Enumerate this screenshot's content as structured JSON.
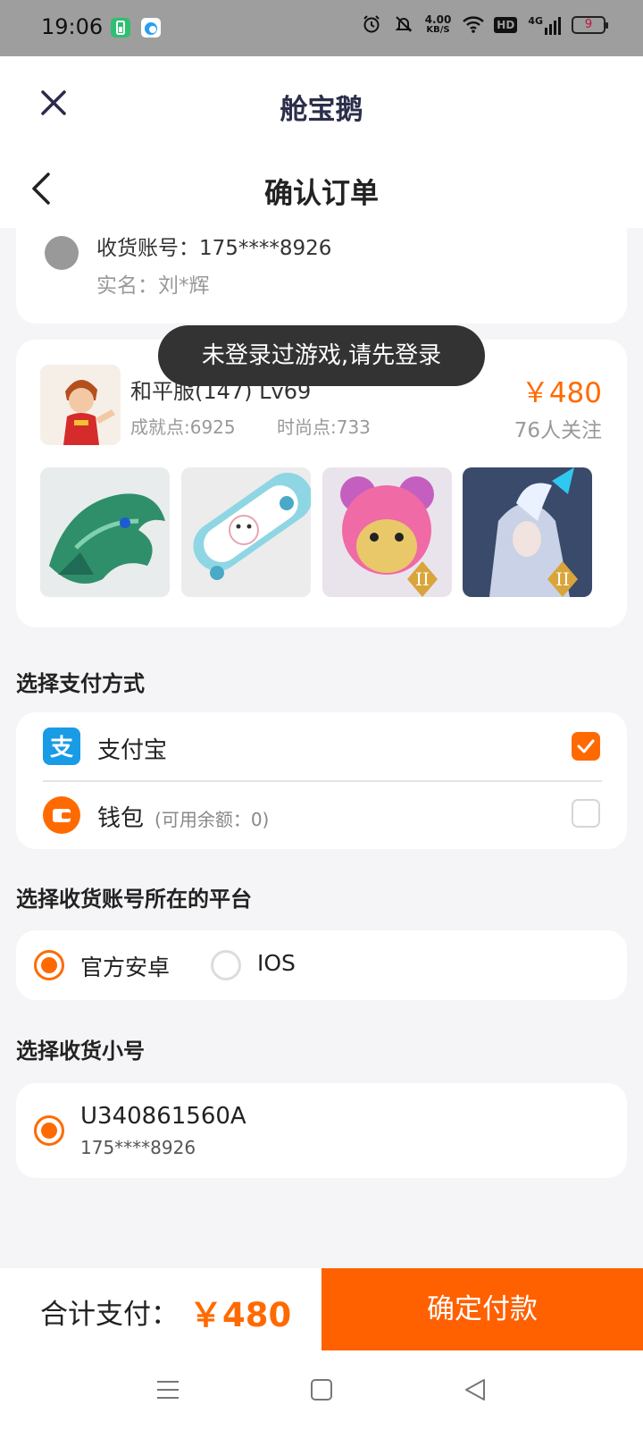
{
  "status_bar": {
    "time": "19:06",
    "speed_value": "4.00",
    "speed_unit": "KB/S",
    "network": "4G",
    "hd_label": "HD",
    "battery": "9",
    "icons": [
      "battery-saver-icon",
      "browser-app-icon",
      "alarm-icon",
      "mute-icon",
      "wifi-icon",
      "hd-icon",
      "signal-icon",
      "battery-icon"
    ]
  },
  "app_bar": {
    "title": "舱宝鹅",
    "close_icon": "close-icon"
  },
  "nav_bar": {
    "title": "确认订单",
    "back_icon": "chevron-left-icon"
  },
  "receiver": {
    "account_line": "收货账号：175****8926",
    "real_name_line": "实名：刘*辉"
  },
  "product": {
    "name": "和平服(147) Lv69",
    "achievement": "成就点:6925",
    "fashion": "时尚点:733",
    "price": "￥480",
    "followers": "76人关注",
    "thumbnails": [
      "dragon-skin",
      "skateboard-skin",
      "pink-bear-skin",
      "armor-skin"
    ]
  },
  "toast": {
    "text": "未登录过游戏,请先登录"
  },
  "payment": {
    "section_title": "选择支付方式",
    "options": [
      {
        "label": "支付宝",
        "sub": "",
        "icon": "alipay-icon",
        "checked": true
      },
      {
        "label": "钱包",
        "sub": "(可用余额：0)",
        "icon": "wallet-icon",
        "checked": false
      }
    ]
  },
  "platform": {
    "section_title": "选择收货账号所在的平台",
    "options": [
      {
        "label": "官方安卓",
        "selected": true
      },
      {
        "label": "IOS",
        "selected": false
      }
    ]
  },
  "sub_account": {
    "section_title": "选择收货小号",
    "id": "U340861560A",
    "phone": "175****8926",
    "selected": true
  },
  "footer": {
    "total_label": "合计支付：",
    "total_price": "￥480",
    "pay_button": "确定付款"
  },
  "colors": {
    "accent": "#ff6a00",
    "alipay": "#1a9be6",
    "toast_bg": "#333333"
  }
}
